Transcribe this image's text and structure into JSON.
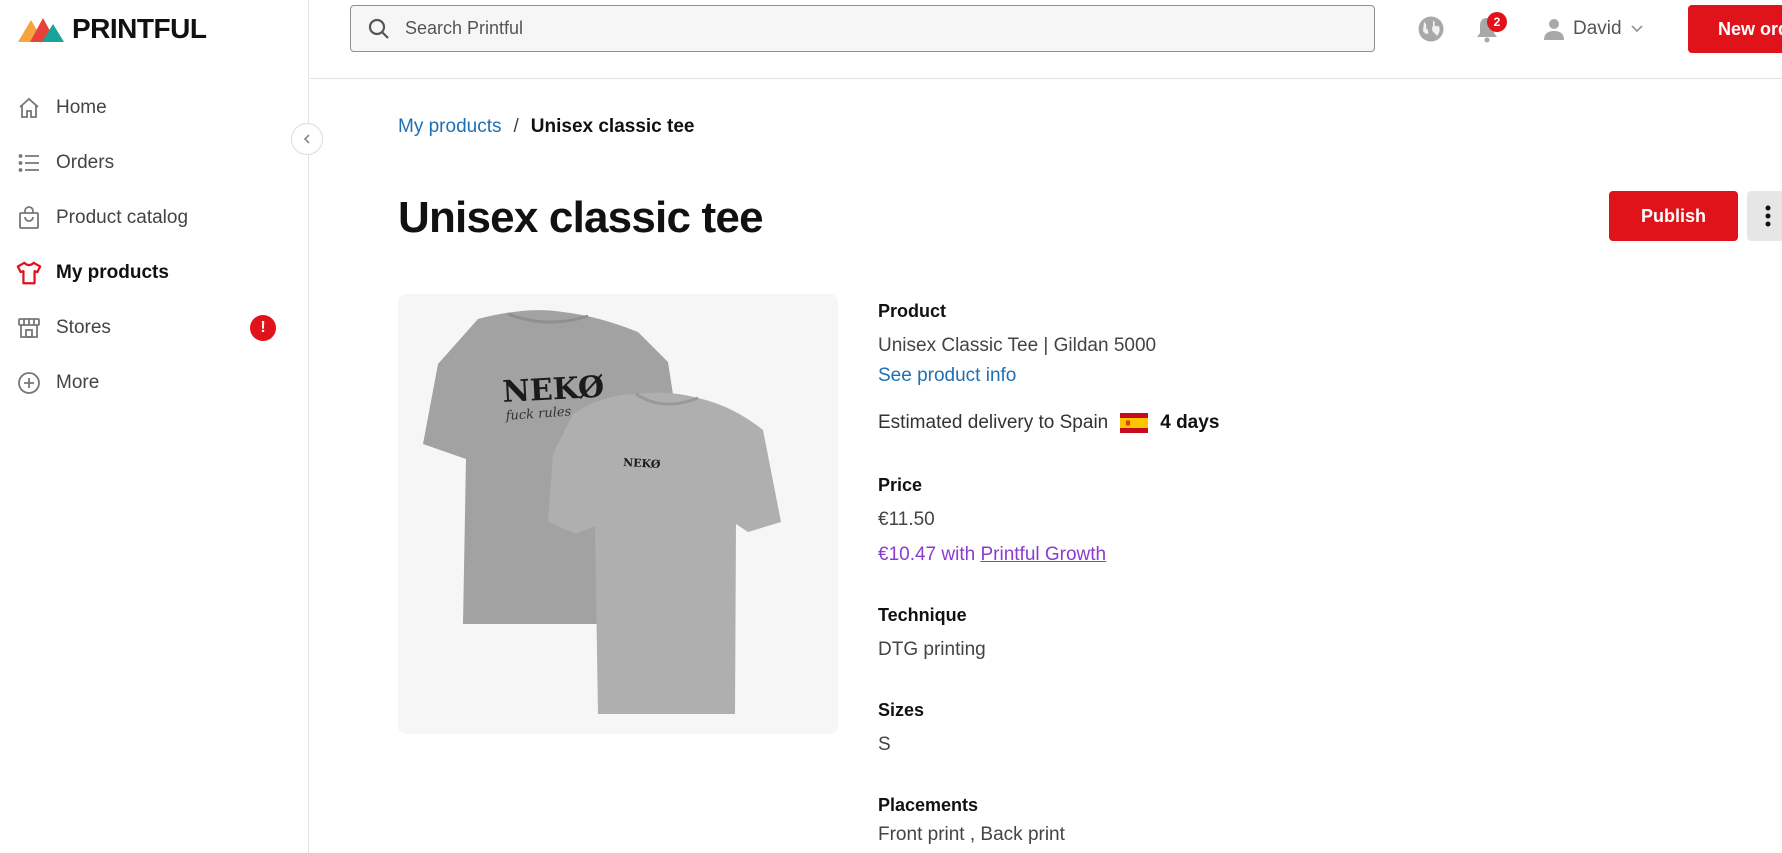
{
  "brand": {
    "name": "PRINTFUL"
  },
  "sidebar": {
    "items": [
      {
        "label": "Home",
        "icon": "home-icon"
      },
      {
        "label": "Orders",
        "icon": "list-icon"
      },
      {
        "label": "Product catalog",
        "icon": "shopping-bag-icon"
      },
      {
        "label": "My products",
        "icon": "tshirt-icon",
        "active": true
      },
      {
        "label": "Stores",
        "icon": "store-icon",
        "badge": "!"
      },
      {
        "label": "More",
        "icon": "plus-circle-icon"
      }
    ]
  },
  "header": {
    "search_placeholder": "Search Printful",
    "notification_count": "2",
    "user_name": "David",
    "new_button_label": "New order"
  },
  "breadcrumb": {
    "parent": "My products",
    "separator": "/",
    "current": "Unisex classic tee"
  },
  "page": {
    "title": "Unisex classic tee",
    "publish_label": "Publish"
  },
  "product": {
    "image_text_back": "NEKØ",
    "image_text_script": "fuck rules",
    "image_text_front": "NEKØ",
    "product_label": "Product",
    "product_name": "Unisex Classic Tee | Gildan 5000",
    "product_info_link": "See product info",
    "delivery_text": "Estimated delivery to Spain",
    "delivery_days": "4 days",
    "price_label": "Price",
    "price": "€11.50",
    "growth_price_prefix": "€10.47 with",
    "growth_link": "Printful Growth",
    "technique_label": "Technique",
    "technique": "DTG printing",
    "sizes_label": "Sizes",
    "sizes": "S",
    "placements_label": "Placements",
    "placements": "Front print , Back print"
  },
  "colors": {
    "accent_red": "#e0131a",
    "link_blue": "#1f6fb5",
    "growth_purple": "#8a3ccf"
  }
}
